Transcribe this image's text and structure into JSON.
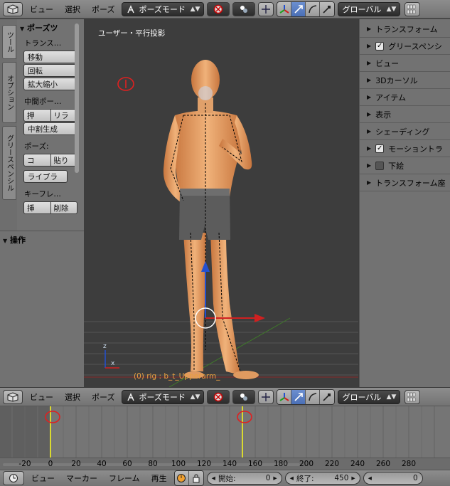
{
  "top_header": {
    "menus": [
      "ビュー",
      "選択",
      "ポーズ"
    ],
    "mode": "ポーズモード",
    "orientation": "グローバル"
  },
  "tool_tabs": [
    "ツール",
    "オプション",
    "グリースペンシル"
  ],
  "tool_panel": {
    "title": "ポーズツ",
    "transform": {
      "label": "トランス…",
      "move": "移動",
      "rotate": "回転",
      "scale": "拡大縮小"
    },
    "inbetween": {
      "label": "中間ポー…",
      "push": "押",
      "relax": "リラ",
      "breakdown": "中割生成"
    },
    "pose": {
      "label": "ポーズ:",
      "copy": "コ",
      "paste": "貼り"
    },
    "library": "ライブラ",
    "keyframe": {
      "label": "キーフレ…",
      "insert": "挿",
      "delete": "削除"
    }
  },
  "operator_panel": {
    "title": "操作"
  },
  "viewport": {
    "title": "ユーザー・平行投影",
    "status": "(0) rig : b_t_Upperarm_"
  },
  "properties_panel": {
    "items": [
      {
        "label": "トランスフォーム",
        "checkbox": "none"
      },
      {
        "label": "グリースペンシ",
        "checkbox": "on"
      },
      {
        "label": "ビュー",
        "checkbox": "none"
      },
      {
        "label": "3Dカーソル",
        "checkbox": "none"
      },
      {
        "label": "アイテム",
        "checkbox": "none"
      },
      {
        "label": "表示",
        "checkbox": "none"
      },
      {
        "label": "シェーディング",
        "checkbox": "none"
      },
      {
        "label": "モーショントラ",
        "checkbox": "on"
      },
      {
        "label": "下絵",
        "checkbox": "off"
      },
      {
        "label": "トランスフォーム座",
        "checkbox": "none"
      }
    ]
  },
  "timeline_header": {
    "menus": [
      "ビュー",
      "選択",
      "ポーズ"
    ],
    "mode": "ポーズモード",
    "orientation": "グローバル"
  },
  "timeline": {
    "ticks": [
      "-20",
      "0",
      "20",
      "40",
      "60",
      "80",
      "100",
      "120",
      "140",
      "160",
      "180",
      "200",
      "220",
      "240",
      "260",
      "280"
    ],
    "keyframes": [
      0,
      150
    ],
    "current_frame": 0
  },
  "bottom_bar": {
    "menus": [
      "ビュー",
      "マーカー",
      "フレーム",
      "再生"
    ],
    "start_label": "開始:",
    "start_value": "0",
    "end_label": "終了:",
    "end_value": "450",
    "current_value": "0"
  },
  "colors": {
    "accent_blue": "#5d82c9",
    "keyframe_yellow": "#d9d930",
    "annotation_red": "#e02020"
  }
}
